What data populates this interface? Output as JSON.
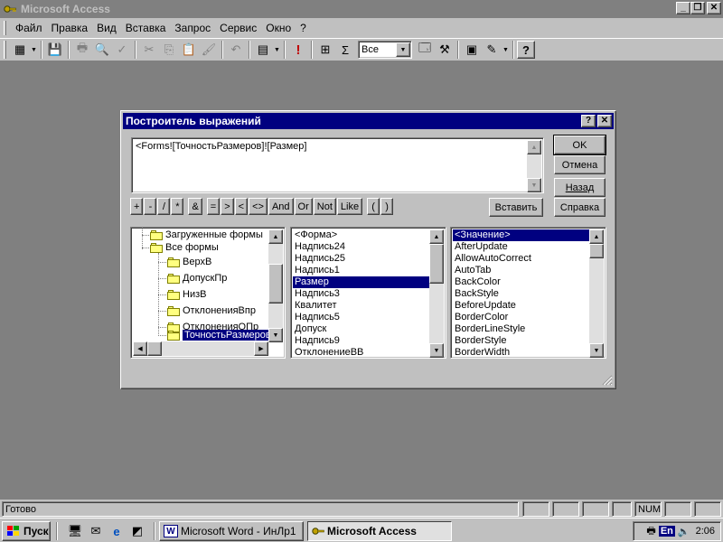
{
  "window": {
    "title": "Microsoft Access"
  },
  "menu": [
    "Файл",
    "Правка",
    "Вид",
    "Вставка",
    "Запрос",
    "Сервис",
    "Окно",
    "?"
  ],
  "toolbar": {
    "combo_value": "Все",
    "exclaim": "!",
    "sigma": "Σ"
  },
  "dialog": {
    "title": "Построитель выражений",
    "expression": "<Forms![ТочностьРазмеров]![Размер]",
    "buttons": {
      "ok": "OK",
      "cancel": "Отмена",
      "back": "Назад",
      "insert": "Вставить",
      "help": "Справка"
    },
    "operators": [
      "+",
      "-",
      "/",
      "*",
      "&",
      "=",
      ">",
      "<",
      "<>",
      "And",
      "Or",
      "Not",
      "Like",
      "(",
      ")"
    ],
    "tree": {
      "loaded_forms": "Загруженные формы",
      "all_forms": "Все формы",
      "children": [
        "ВерхВ",
        "ДопускПр",
        "НизВ",
        "ОтклоненияВпр",
        "ОтклоненияОПр",
        "ТочностьРазмеров"
      ],
      "selected": "ТочностьРазмеров"
    },
    "controls": [
      "<Форма>",
      "Надпись24",
      "Надпись25",
      "Надпись1",
      "Размер",
      "Надпись3",
      "Квалитет",
      "Надпись5",
      "Допуск",
      "Надпись9",
      "ОтклонениеВВ"
    ],
    "controls_selected": "Размер",
    "properties": [
      "<Значение>",
      "AfterUpdate",
      "AllowAutoCorrect",
      "AutoTab",
      "BackColor",
      "BackStyle",
      "BeforeUpdate",
      "BorderColor",
      "BorderLineStyle",
      "BorderStyle",
      "BorderWidth"
    ],
    "properties_selected": "<Значение>"
  },
  "status": {
    "text": "Готово",
    "num": "NUM"
  },
  "taskbar": {
    "start": "Пуск",
    "tasks": [
      "Microsoft Word - ИнЛр1",
      "Microsoft Access"
    ],
    "lang": "En",
    "clock": "2:06"
  },
  "colors": {
    "title_active": "#000080",
    "desktop": "#808080",
    "face": "#c0c0c0"
  }
}
